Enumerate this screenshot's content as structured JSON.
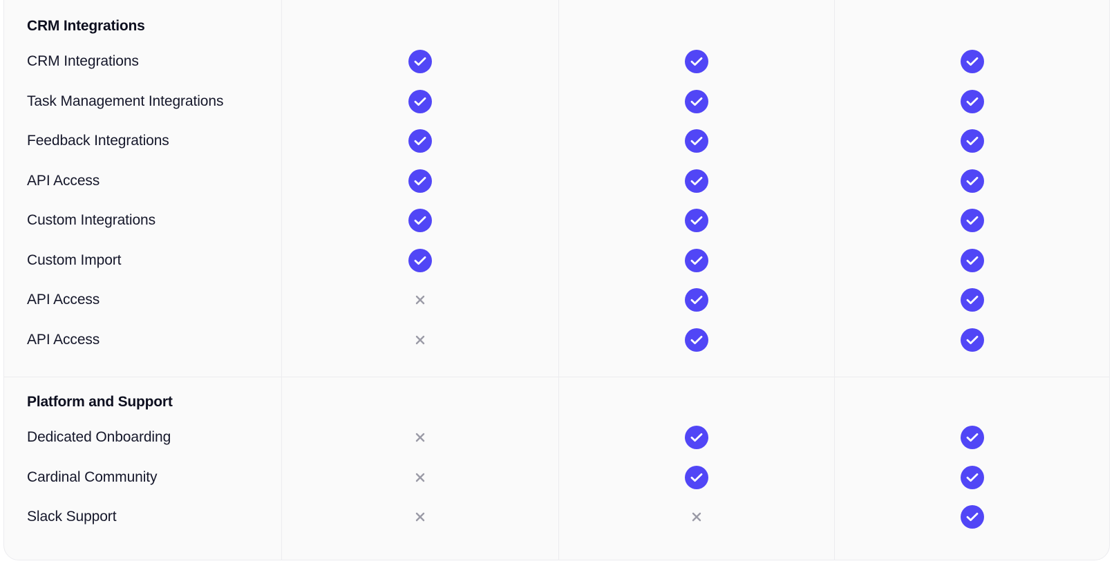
{
  "colors": {
    "check": "#5146f6",
    "cross": "#9a9aa6",
    "background": "#fafafa",
    "divider": "#ececef",
    "text": "#0d0f1f"
  },
  "plans_columns": 3,
  "sections": [
    {
      "title": "CRM Integrations",
      "rows": [
        {
          "label": "CRM Integrations",
          "values": [
            "check-icon",
            "check-icon",
            "check-icon"
          ]
        },
        {
          "label": "Task Management Integrations",
          "values": [
            "check-icon",
            "check-icon",
            "check-icon"
          ]
        },
        {
          "label": "Feedback Integrations",
          "values": [
            "check-icon",
            "check-icon",
            "check-icon"
          ]
        },
        {
          "label": "API Access",
          "values": [
            "check-icon",
            "check-icon",
            "check-icon"
          ]
        },
        {
          "label": "Custom Integrations",
          "values": [
            "check-icon",
            "check-icon",
            "check-icon"
          ]
        },
        {
          "label": "Custom Import",
          "values": [
            "check-icon",
            "check-icon",
            "check-icon"
          ]
        },
        {
          "label": "API Access",
          "values": [
            "cross-icon",
            "check-icon",
            "check-icon"
          ]
        },
        {
          "label": "API Access",
          "values": [
            "cross-icon",
            "check-icon",
            "check-icon"
          ]
        }
      ]
    },
    {
      "title": "Platform and Support",
      "rows": [
        {
          "label": "Dedicated Onboarding",
          "values": [
            "cross-icon",
            "check-icon",
            "check-icon"
          ]
        },
        {
          "label": "Cardinal Community",
          "values": [
            "cross-icon",
            "check-icon",
            "check-icon"
          ]
        },
        {
          "label": "Slack Support",
          "values": [
            "cross-icon",
            "cross-icon",
            "check-icon"
          ]
        }
      ]
    }
  ]
}
